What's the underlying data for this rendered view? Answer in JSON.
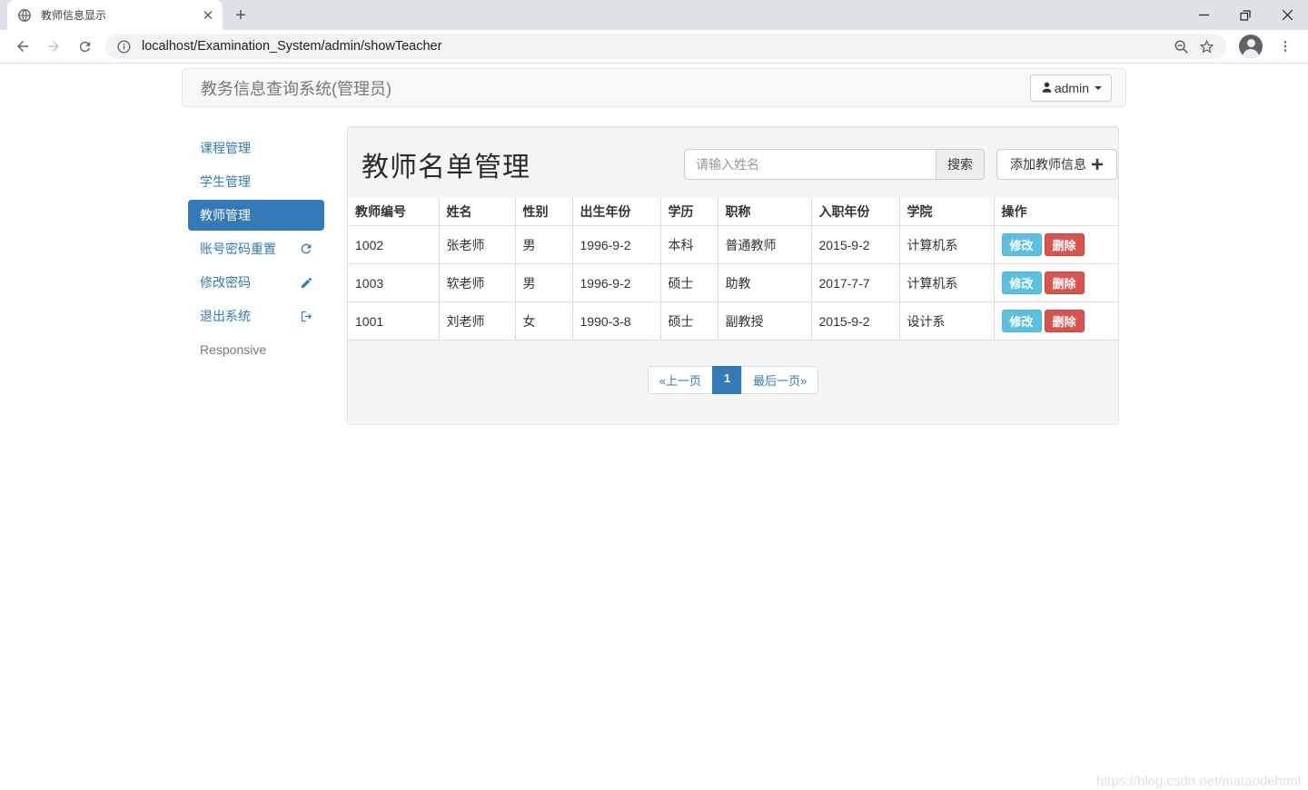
{
  "browser": {
    "tab_title": "教师信息显示",
    "url": "localhost/Examination_System/admin/showTeacher"
  },
  "navbar": {
    "brand": "教务信息查询系统(管理员)",
    "user": "admin"
  },
  "sidebar": {
    "items": [
      {
        "name": "courses",
        "label": "课程管理",
        "icon": null,
        "active": false,
        "plain": false
      },
      {
        "name": "students",
        "label": "学生管理",
        "icon": null,
        "active": false,
        "plain": false
      },
      {
        "name": "teachers",
        "label": "教师管理",
        "icon": null,
        "active": true,
        "plain": false
      },
      {
        "name": "reset-password",
        "label": "账号密码重置",
        "icon": "refresh-icon",
        "active": false,
        "plain": false
      },
      {
        "name": "change-password",
        "label": "修改密码",
        "icon": "pencil-icon",
        "active": false,
        "plain": false
      },
      {
        "name": "logout",
        "label": "退出系统",
        "icon": "sign-out-icon",
        "active": false,
        "plain": false
      },
      {
        "name": "responsive",
        "label": "Responsive",
        "icon": null,
        "active": false,
        "plain": true
      }
    ]
  },
  "main": {
    "title": "教师名单管理",
    "search": {
      "placeholder": "请输入姓名",
      "button": "搜索"
    },
    "add_button": {
      "label": "添加教师信息",
      "icon": "plus-icon"
    },
    "table": {
      "headers": [
        "教师编号",
        "姓名",
        "性别",
        "出生年份",
        "学历",
        "职称",
        "入职年份",
        "学院",
        "操作"
      ],
      "rows": [
        [
          "1002",
          "张老师",
          "男",
          "1996-9-2",
          "本科",
          "普通教师",
          "2015-9-2",
          "计算机系"
        ],
        [
          "1003",
          "软老师",
          "男",
          "1996-9-2",
          "硕士",
          "助教",
          "2017-7-7",
          "计算机系"
        ],
        [
          "1001",
          "刘老师",
          "女",
          "1990-3-8",
          "硕士",
          "副教授",
          "2015-9-2",
          "设计系"
        ]
      ],
      "actions": {
        "edit": "修改",
        "delete": "删除"
      }
    },
    "pagination": {
      "prev": "«上一页",
      "current": "1",
      "last": "最后一页»"
    }
  },
  "watermark": "https://blog.csdn.net/mataodehtml",
  "colors": {
    "accent": "#337ab7",
    "info_button": "#5bc0de",
    "danger_button": "#d9534f",
    "navbar_bg": "#f8f8f8",
    "panel_bg": "#f5f5f5"
  }
}
